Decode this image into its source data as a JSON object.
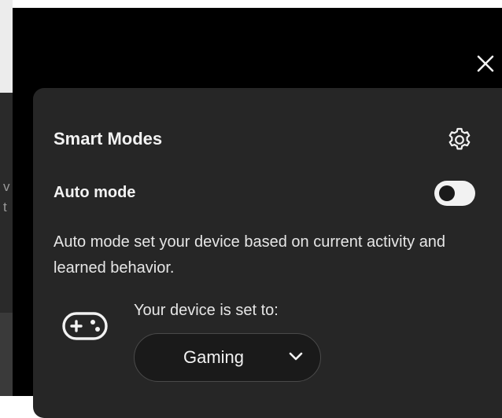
{
  "dialog": {
    "close_icon": "close-icon"
  },
  "smart_modes": {
    "title": "Smart Modes",
    "settings_icon": "gear-icon",
    "auto_mode": {
      "label": "Auto mode",
      "enabled": true,
      "description": "Auto mode set your device based on current activity and learned behavior."
    },
    "device": {
      "icon": "game-controller-icon",
      "label": "Your device is set to:",
      "selected_mode": "Gaming",
      "dropdown_icon": "chevron-down-icon"
    }
  },
  "colors": {
    "overlay": "#000000",
    "panel": "#262626",
    "text": "#f2f2f2",
    "toggle_track": "#f2f2f2",
    "toggle_knob": "#1a1a1a"
  }
}
